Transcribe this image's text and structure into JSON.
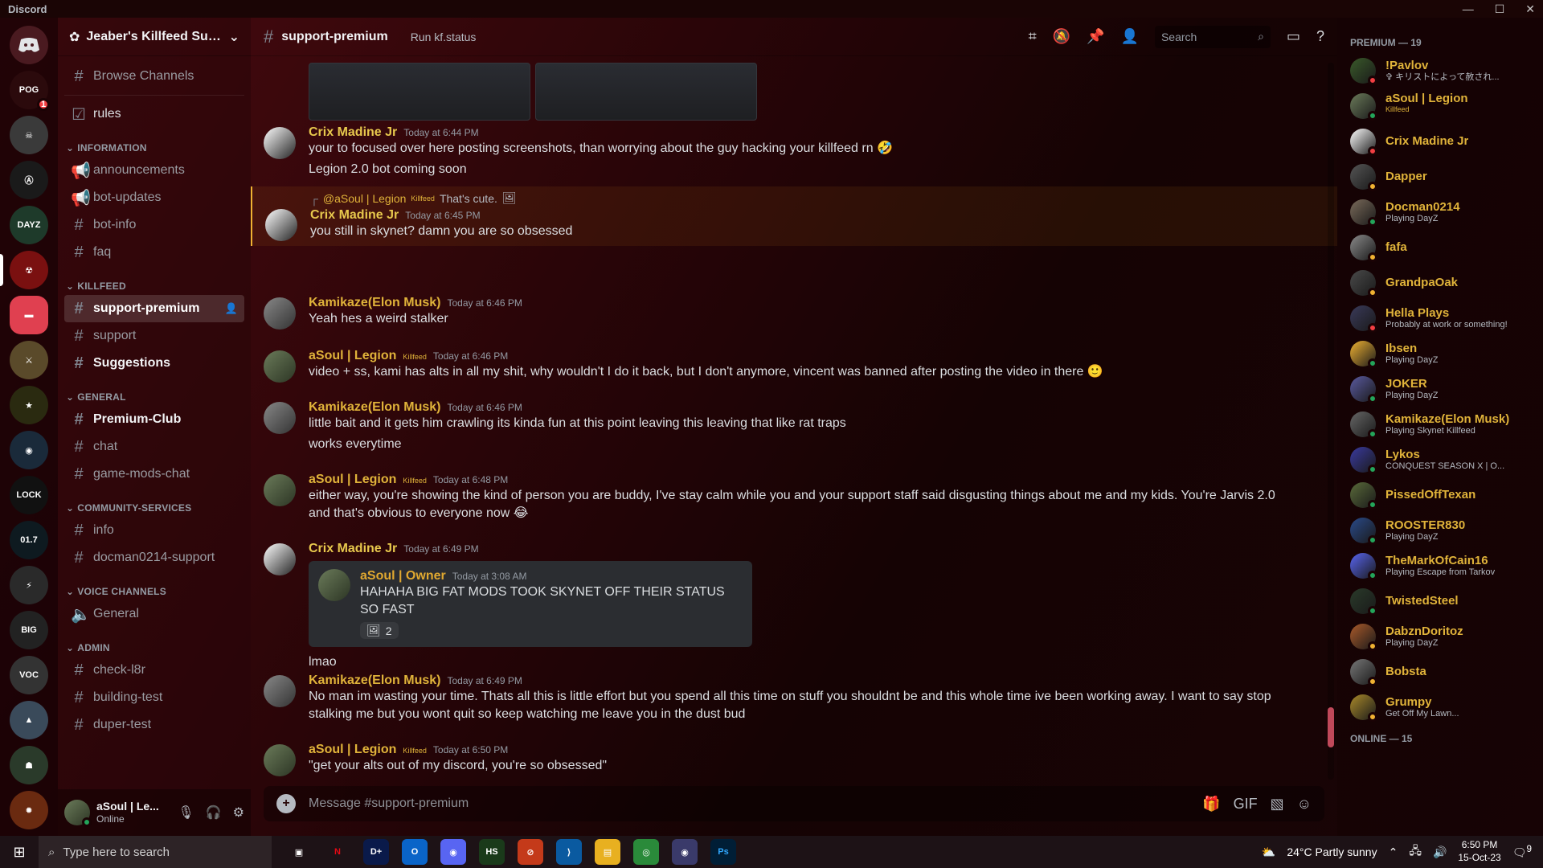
{
  "app": {
    "title": "Discord"
  },
  "server": {
    "name": "Jeaber's Killfeed Sup...",
    "home_badge": "1"
  },
  "channels": {
    "browse": "Browse Channels",
    "top": [
      {
        "label": "rules"
      }
    ],
    "categories": [
      {
        "name": "INFORMATION",
        "items": [
          "announcements",
          "bot-updates",
          "bot-info",
          "faq"
        ]
      },
      {
        "name": "KILLFEED",
        "items": [
          "support-premium",
          "support",
          "Suggestions"
        ]
      },
      {
        "name": "GENERAL",
        "items": [
          "Premium-Club",
          "chat",
          "game-mods-chat"
        ]
      },
      {
        "name": "COMMUNITY-SERVICES",
        "items": [
          "info",
          "docman0214-support"
        ]
      },
      {
        "name": "VOICE CHANNELS",
        "items": [
          "General"
        ]
      },
      {
        "name": "ADMIN",
        "items": [
          "check-l8r",
          "building-test",
          "duper-test"
        ]
      }
    ]
  },
  "user": {
    "name": "aSoul | Le...",
    "status": "Online"
  },
  "chat": {
    "channel": "support-premium",
    "topic": "Run kf.status",
    "search_placeholder": "Search",
    "composer_placeholder": "Message #support-premium"
  },
  "messages": [
    {
      "author": "Crix Madine Jr",
      "time": "Today at 6:44 PM",
      "lines": [
        "your to focused over here posting screenshots, than worrying about the guy hacking your killfeed rn 🤣",
        "Legion 2.0 bot coming soon"
      ]
    },
    {
      "reply_to": "@aSoul | Legion",
      "reply_tag": "Killfeed",
      "reply_text": "That's cute.",
      "author": "Crix Madine Jr",
      "time": "Today at 6:45 PM",
      "lines": [
        "you still in skynet? damn you are so obsessed"
      ]
    },
    {
      "author": "Kamikaze(Elon Musk)",
      "time": "Today at 6:46 PM",
      "lines": [
        "Yeah hes a weird stalker"
      ]
    },
    {
      "author": "aSoul | Legion",
      "tag": "Killfeed",
      "time": "Today at 6:46 PM",
      "lines": [
        "video + ss, kami has alts in all my shit, why wouldn't I do it back, but I don't anymore, vincent was banned after posting the video in there 🙂"
      ]
    },
    {
      "author": "Kamikaze(Elon Musk)",
      "time": "Today at 6:46 PM",
      "lines": [
        "little bait and it gets him crawling its kinda fun at this point leaving this leaving that like rat traps",
        "works everytime"
      ]
    },
    {
      "author": "aSoul | Legion",
      "tag": "Killfeed",
      "time": "Today at 6:48 PM",
      "lines": [
        "either way, you're showing the kind of person you are buddy, I've stay calm while you and your support staff said disgusting things about me and my kids. You're Jarvis 2.0 and that's obvious to everyone now 😂"
      ]
    },
    {
      "author": "Crix Madine Jr",
      "time": "Today at 6:49 PM",
      "embed": {
        "author": "aSoul | Owner",
        "time": "Today at 3:08 AM",
        "text": "HAHAHA BIG FAT MODS TOOK SKYNET OFF THEIR STATUS SO FAST",
        "reaction_count": "2"
      },
      "lines": [
        "lmao"
      ]
    },
    {
      "author": "Kamikaze(Elon Musk)",
      "time": "Today at 6:49 PM",
      "lines": [
        "No man im wasting your time. Thats all this is little effort but you spend all this time on stuff you shouldnt be and this whole time ive been working away. I want to say stop stalking me but you wont quit so keep watching me leave you in the dust bud"
      ]
    },
    {
      "author": "aSoul | Legion",
      "tag": "Killfeed",
      "time": "Today at 6:50 PM",
      "lines": [
        "\"get your alts out of my discord, you're so obsessed\""
      ]
    }
  ],
  "members": {
    "premium_header": "PREMIUM — 19",
    "online_header": "ONLINE — 15",
    "list": [
      {
        "name": "!Pavlov",
        "sub": "✞ キリストによって赦され...",
        "status": "dnd"
      },
      {
        "name": "aSoul | Legion",
        "tag": "Killfeed",
        "sub": "",
        "status": "online"
      },
      {
        "name": "Crix Madine Jr",
        "sub": "",
        "status": "dnd"
      },
      {
        "name": "Dapper",
        "sub": "",
        "status": "idle"
      },
      {
        "name": "Docman0214",
        "sub": "Playing DayZ",
        "status": "online"
      },
      {
        "name": "fafa",
        "sub": "",
        "status": "idle"
      },
      {
        "name": "GrandpaOak",
        "sub": "",
        "status": "idle"
      },
      {
        "name": "Hella Plays",
        "sub": "Probably at work or something!",
        "status": "dnd"
      },
      {
        "name": "Ibsen",
        "sub": "Playing DayZ",
        "status": "online"
      },
      {
        "name": "JOKER",
        "sub": "Playing DayZ",
        "status": "online"
      },
      {
        "name": "Kamikaze(Elon Musk)",
        "sub": "Playing Skynet Killfeed",
        "status": "online"
      },
      {
        "name": "Lykos",
        "sub": "CONQUEST SEASON X | O...",
        "status": "online"
      },
      {
        "name": "PissedOffTexan",
        "sub": "",
        "status": "online"
      },
      {
        "name": "ROOSTER830",
        "sub": "Playing DayZ",
        "status": "online"
      },
      {
        "name": "TheMarkOfCain16",
        "sub": "Playing Escape from Tarkov",
        "status": "online"
      },
      {
        "name": "TwistedSteel",
        "sub": "",
        "status": "online"
      },
      {
        "name": "DabznDoritoz",
        "sub": "Playing DayZ",
        "status": "idle"
      },
      {
        "name": "Bobsta",
        "sub": "",
        "status": "idle"
      },
      {
        "name": "Grumpy",
        "sub": "Get Off My Lawn...",
        "status": "idle"
      }
    ]
  },
  "taskbar": {
    "search_placeholder": "Type here to search",
    "weather": "24°C  Partly sunny",
    "time": "6:50 PM",
    "date": "15-Oct-23",
    "notif_count": "9"
  },
  "colors": {
    "accent": "#e0b33a",
    "bg": "#2a0508"
  }
}
